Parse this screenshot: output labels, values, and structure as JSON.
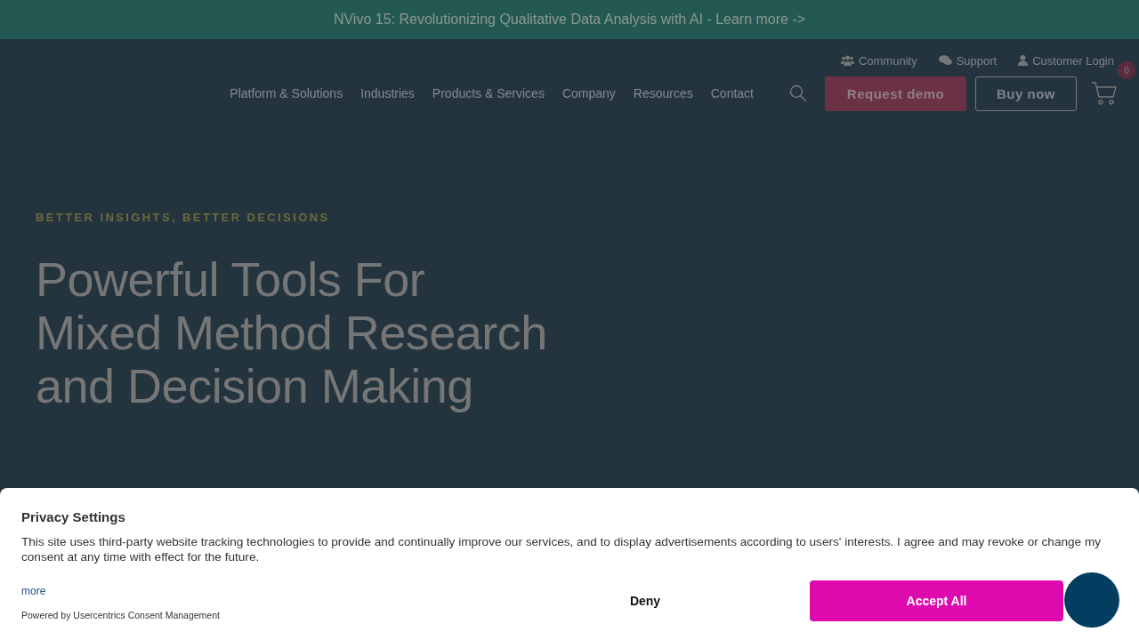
{
  "announcement": "NVivo 15: Revolutionizing Qualitative Data Analysis with AI - Learn more ->",
  "utility_links": [
    {
      "label": "Community",
      "kind": "community"
    },
    {
      "label": "Support",
      "kind": "support"
    },
    {
      "label": "Customer Login",
      "kind": "login"
    }
  ],
  "nav": [
    "Platform & Solutions",
    "Industries",
    "Products & Services",
    "Company",
    "Resources",
    "Contact"
  ],
  "buttons": {
    "primary": "Request demo",
    "secondary": "Buy now"
  },
  "cart": {
    "count": "0"
  },
  "hero": {
    "eyebrow": "BETTER INSIGHTS, BETTER DECISIONS",
    "heading": [
      "Powerful Tools For",
      "Mixed Method Research",
      "and Decision Making"
    ]
  },
  "consent": {
    "title": "Privacy Settings",
    "body": "This site uses third-party website tracking technologies to provide and continually improve our services, and to display advertisements according to users' interests. I agree and may revoke or change my consent at any time with effect for the future.",
    "more": "more",
    "powered_by": "Powered by Usercentrics Consent Management",
    "deny": "Deny",
    "accept": "Accept All"
  }
}
